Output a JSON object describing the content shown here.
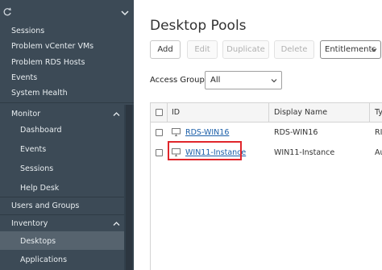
{
  "sidebar": {
    "items": [
      {
        "label": "Sessions"
      },
      {
        "label": "Problem vCenter VMs"
      },
      {
        "label": "Problem RDS Hosts"
      },
      {
        "label": "Events"
      },
      {
        "label": "System Health"
      }
    ],
    "monitor": {
      "label": "Monitor",
      "items": [
        {
          "label": "Dashboard"
        },
        {
          "label": "Events"
        },
        {
          "label": "Sessions"
        },
        {
          "label": "Help Desk"
        }
      ]
    },
    "users_groups": {
      "label": "Users and Groups"
    },
    "inventory": {
      "label": "Inventory",
      "items": [
        {
          "label": "Desktops"
        },
        {
          "label": "Applications"
        }
      ]
    }
  },
  "main": {
    "title": "Desktop Pools",
    "toolbar": {
      "add": "Add",
      "edit": "Edit",
      "duplicate": "Duplicate",
      "delete": "Delete",
      "entitlements": "Entitlements"
    },
    "access_group": {
      "label": "Access Group",
      "value": "All"
    },
    "table": {
      "columns": [
        "ID",
        "Display Name",
        "Ty"
      ],
      "rows": [
        {
          "id": "RDS-WIN16",
          "display_name": "RDS-WIN16",
          "type": "RI"
        },
        {
          "id": "WIN11-Instance",
          "display_name": "WIN11-Instance",
          "type": "Au"
        }
      ]
    }
  },
  "colors": {
    "sidebar_bg": "#3c4a56",
    "active_item_bg": "#56636e",
    "link": "#1a5ea8",
    "highlight_border": "#e0262b"
  }
}
